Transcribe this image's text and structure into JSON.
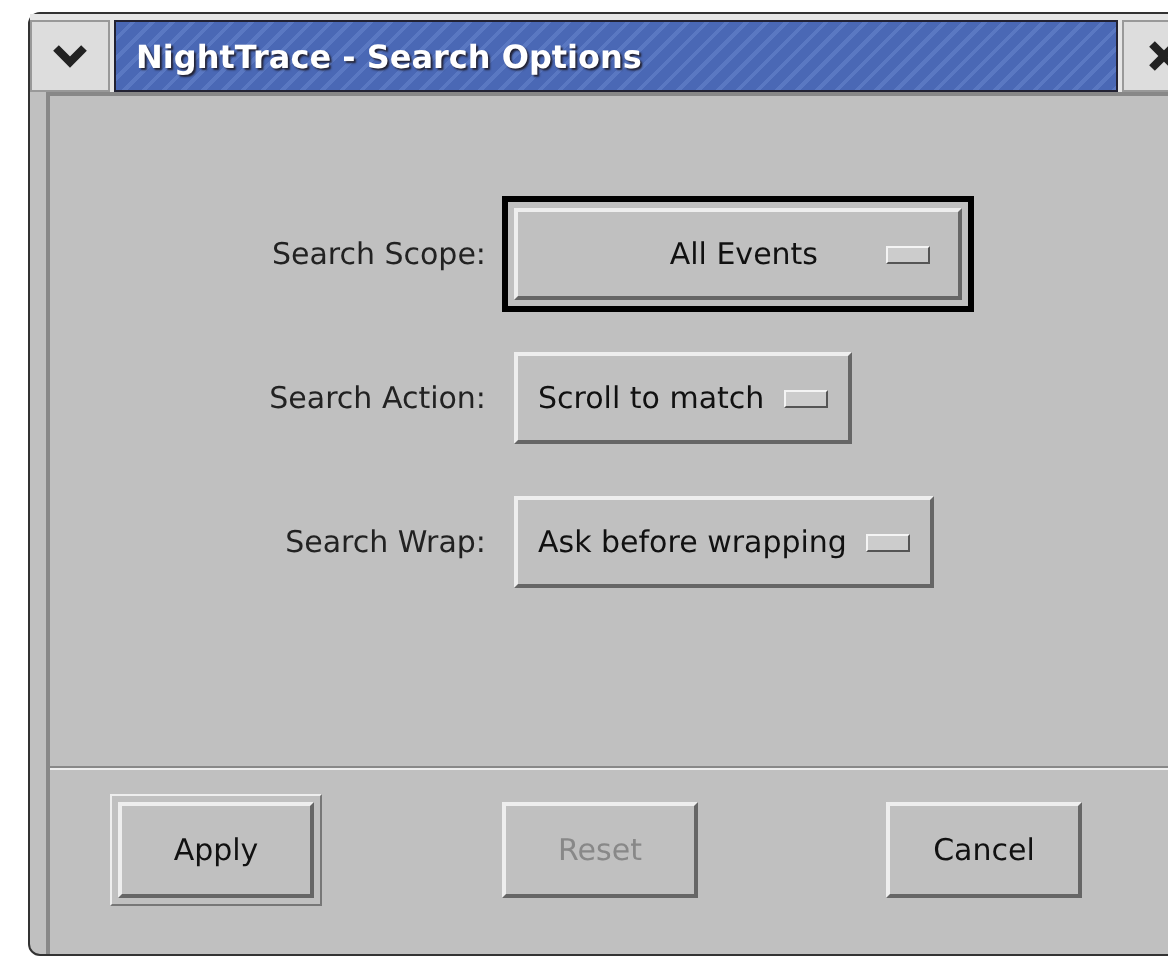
{
  "window": {
    "title": "NightTrace - Search Options"
  },
  "fields": [
    {
      "label": "Search Scope:",
      "value": "All Events",
      "focused": true
    },
    {
      "label": "Search Action:",
      "value": "Scroll to match",
      "focused": false
    },
    {
      "label": "Search Wrap:",
      "value": "Ask before wrapping",
      "focused": false
    }
  ],
  "buttons": [
    {
      "label": "Apply",
      "disabled": false,
      "default": true
    },
    {
      "label": "Reset",
      "disabled": true,
      "default": false
    },
    {
      "label": "Cancel",
      "disabled": false,
      "default": false
    }
  ]
}
